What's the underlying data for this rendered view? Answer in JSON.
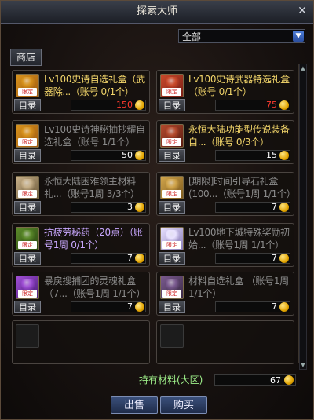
{
  "window": {
    "title": "探索大师"
  },
  "filter": {
    "selected": "全部"
  },
  "tabs": [
    {
      "label": "商店"
    }
  ],
  "items": [
    {
      "name": "Lv100史诗自选礼盒（武器除...（账号 0/1个）",
      "menu": "目录",
      "price": "150",
      "price_color": "red",
      "name_color": "#f2d56a",
      "icon": "gift-box-gold",
      "badge": "限定"
    },
    {
      "name": "Lv100史诗武器特选礼盒 （账号 0/1个）",
      "menu": "目录",
      "price": "75",
      "price_color": "red",
      "name_color": "#f2d56a",
      "icon": "gift-box-red",
      "badge": "限定"
    },
    {
      "name": "Lv100史诗神秘抽抄耀自选礼盒（账号 1/1个）",
      "menu": "目录",
      "price": "50",
      "price_color": "white",
      "name_color": "#8b8b8b",
      "icon": "gift-box-gold",
      "badge": "限定"
    },
    {
      "name": "永恒大陆功能型传说装备自...（账号 0/3个）",
      "menu": "目录",
      "price": "15",
      "price_color": "white",
      "name_color": "#f2d56a",
      "icon": "equipment-box",
      "badge": "限定"
    },
    {
      "name": "永恒大陆困难领主材料礼...（账号1周 3/3个）",
      "menu": "目录",
      "price": "3",
      "price_color": "white",
      "name_color": "#8b8b8b",
      "icon": "material-box",
      "badge": "限定"
    },
    {
      "name": "[期限]时间引导石礼盒(100...（账号1周 1/1个）",
      "menu": "目录",
      "price": "7",
      "price_color": "white",
      "name_color": "#8b8b8b",
      "icon": "stone-box",
      "badge": "限定"
    },
    {
      "name": "抗疲劳秘药（20点）（账号1周 0/1个）",
      "menu": "目录",
      "price": "7",
      "price_color": "white",
      "name_color": "#c9a8ff",
      "icon": "potion",
      "badge": "限定"
    },
    {
      "name": "Lv100地下城特殊奖励初始...（账号1周 1/1个）",
      "menu": "目录",
      "price": "7",
      "price_color": "white",
      "name_color": "#8b8b8b",
      "icon": "scroll-box",
      "badge": "限定"
    },
    {
      "name": "暴戾搜捕团的灵魂礼盒（7...（账号1周 1/1个）",
      "menu": "目录",
      "price": "7",
      "price_color": "white",
      "name_color": "#8b8b8b",
      "icon": "soul-box-purple",
      "badge": "限定"
    },
    {
      "name": "材料自选礼盒 （账号1周 1/1个）",
      "menu": "目录",
      "price": "7",
      "price_color": "white",
      "name_color": "#8b8b8b",
      "icon": "soul-box-dark",
      "badge": "限定"
    }
  ],
  "footer": {
    "holding_label": "持有材料(大区)",
    "holding_value": "67",
    "sell_label": "出售",
    "buy_label": "购买"
  }
}
